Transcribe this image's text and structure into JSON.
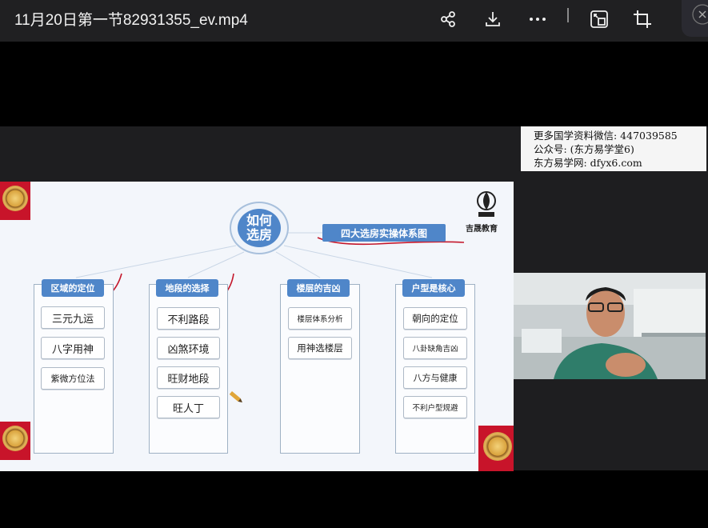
{
  "window": {
    "title": "11月20日第一节82931355_ev.mp4"
  },
  "toolbar": {
    "icons": [
      "share-icon",
      "download-icon",
      "more-icon",
      "picture-in-picture-icon",
      "crop-icon"
    ]
  },
  "watermark": {
    "line1": "更多国学资料微信: 447039585",
    "line2": "公众号: (东方易学堂6)",
    "line3": "东方易学网: dfyx6.com"
  },
  "slide": {
    "center_title": "如何\n选房",
    "system_label": "四大选房实操体系图",
    "logo_text": "吉晟教育",
    "columns": [
      {
        "heading": "区域的定位",
        "items": [
          "三元九运",
          "八字用神",
          "紫微方位法"
        ]
      },
      {
        "heading": "地段的选择",
        "items": [
          "不利路段",
          "凶煞环境",
          "旺财地段",
          "旺人丁"
        ]
      },
      {
        "heading": "楼层的吉凶",
        "items": [
          "楼层体系分析",
          "用神选楼层"
        ]
      },
      {
        "heading": "户型是核心",
        "items": [
          "朝向的定位",
          "八卦缺角吉凶",
          "八方与健康",
          "不利户型规避"
        ]
      }
    ]
  },
  "colors": {
    "accent": "#4f86c9",
    "annotation": "#c4182c"
  }
}
